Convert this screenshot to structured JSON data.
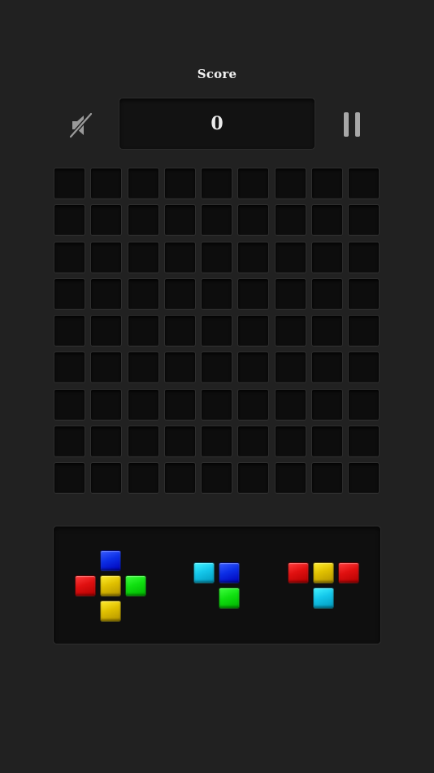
{
  "header": {
    "score_label": "Score",
    "score_value": "0"
  },
  "icons": {
    "mute": "speaker-muted-icon",
    "pause": "pause-icon"
  },
  "board": {
    "rows": 9,
    "cols": 9,
    "filled_cells": []
  },
  "colors": {
    "background": "#212121",
    "cell_empty": "#0d0d0d",
    "red": "#e01010",
    "yellow": "#e0c000",
    "green": "#10e010",
    "blue": "#0c2fe6",
    "cyan": "#14c6ea"
  },
  "pieces": [
    {
      "name": "plus",
      "blocks": [
        {
          "row": 0,
          "col": 1,
          "color": "blue"
        },
        {
          "row": 1,
          "col": 0,
          "color": "red"
        },
        {
          "row": 1,
          "col": 1,
          "color": "yellow"
        },
        {
          "row": 1,
          "col": 2,
          "color": "green"
        },
        {
          "row": 2,
          "col": 1,
          "color": "yellow"
        }
      ]
    },
    {
      "name": "corner",
      "blocks": [
        {
          "row": 0,
          "col": 0,
          "color": "cyan"
        },
        {
          "row": 0,
          "col": 1,
          "color": "blue"
        },
        {
          "row": 1,
          "col": 1,
          "color": "green"
        }
      ]
    },
    {
      "name": "t-shape",
      "blocks": [
        {
          "row": 0,
          "col": 0,
          "color": "red"
        },
        {
          "row": 0,
          "col": 1,
          "color": "yellow"
        },
        {
          "row": 0,
          "col": 2,
          "color": "red"
        },
        {
          "row": 1,
          "col": 1,
          "color": "cyan"
        }
      ]
    }
  ]
}
